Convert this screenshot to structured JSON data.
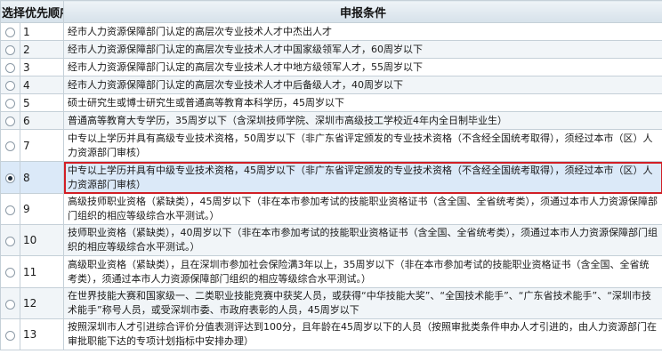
{
  "header": {
    "select_label": "选择",
    "order_label": "优先顺序",
    "condition_label": "申报条件"
  },
  "selected_row": 7,
  "colors": {
    "highlight_border": "#d21f26",
    "header_bg": "#dde6ee",
    "selected_bg": "#dbe9f8"
  },
  "rows": [
    {
      "order": "1",
      "condition": "经市人力资源保障部门认定的高层次专业技术人才中杰出人才"
    },
    {
      "order": "2",
      "condition": "经市人力资源保障部门认定的高层次专业技术人才中国家级领军人才，60周岁以下"
    },
    {
      "order": "3",
      "condition": "经市人力资源保障部门认定的高层次专业技术人才中地方级领军人才，55周岁以下"
    },
    {
      "order": "4",
      "condition": "经市人力资源保障部门认定的高层次专业技术人才中后备级人才，40周岁以下"
    },
    {
      "order": "5",
      "condition": "硕士研究生或博士研究生或普通高等教育本科学历，45周岁以下"
    },
    {
      "order": "6",
      "condition": "普通高等教育大专学历，35周岁以下（含深圳技师学院、深圳市高级技工学校近4年内全日制毕业生）"
    },
    {
      "order": "7",
      "condition": "中专以上学历并具有高级专业技术资格，50周岁以下（非广东省评定颁发的专业技术资格（不含经全国统考取得），须经过本市（区）人力资源部门审核）"
    },
    {
      "order": "8",
      "condition": "中专以上学历并具有中级专业技术资格，45周岁以下（非广东省评定颁发的专业技术资格（不含经全国统考取得），须经过本市（区）人力资源部门审核）"
    },
    {
      "order": "9",
      "condition": "高级技师职业资格（紧缺类），45周岁以下（非在本市参加考试的技能职业资格证书（含全国、全省统考类），须通过本市人力资源保障部门组织的相应等级综合水平测试。）"
    },
    {
      "order": "10",
      "condition": "技师职业资格（紧缺类），40周岁以下（非在本市参加考试的技能职业资格证书（含全国、全省统考类），须通过本市人力资源保障部门组织的相应等级综合水平测试。）"
    },
    {
      "order": "11",
      "condition": "高级职业资格（紧缺类），且在深圳市参加社会保险满3年以上，35周岁以下（非在本市参加考试的技能职业资格证书（含全国、全省统考类），须通过本市人力资源保障部门组织的相应等级综合水平测试。）"
    },
    {
      "order": "12",
      "condition": "在世界技能大赛和国家级一、二类职业技能竞赛中获奖人员，或获得“中华技能大奖”、“全国技术能手”、“广东省技术能手”、“深圳市技术能手”称号人员，或受深圳市委、市政府表彰的人员，45周岁以下"
    },
    {
      "order": "13",
      "condition": "按照深圳市人才引进综合评价分值表测评达到100分，且年龄在45周岁以下的人员（按照审批类条件申办人才引进的，由人力资源部门在审批职能下达的专项计划指标中安排办理）"
    }
  ]
}
